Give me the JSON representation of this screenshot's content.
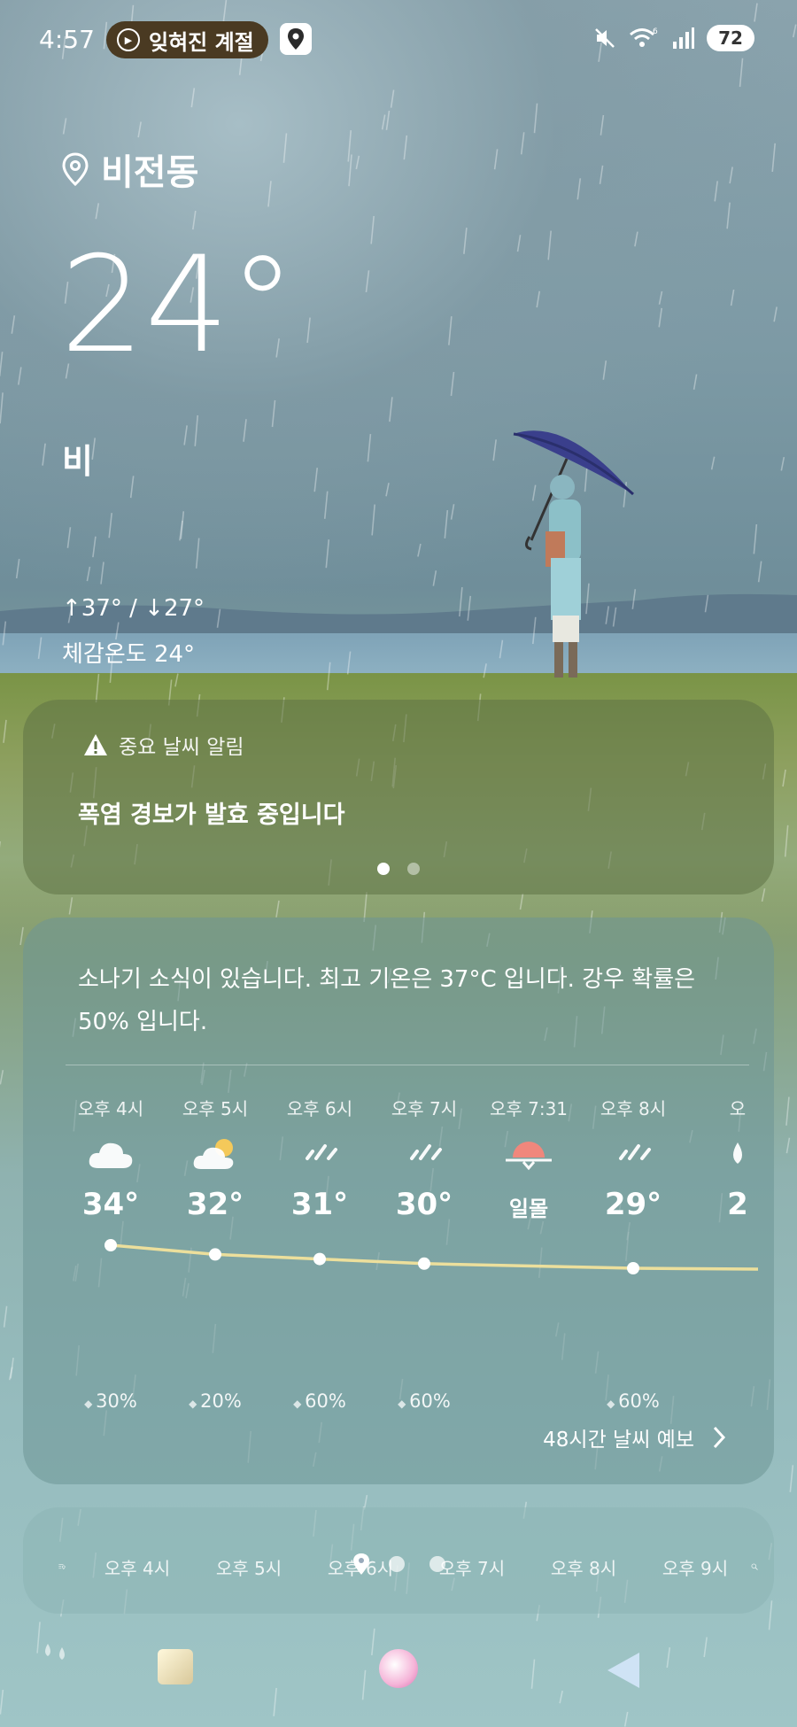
{
  "status_bar": {
    "time": "4:57",
    "notification_label": "잊혀진 계절",
    "battery": "72"
  },
  "location": "비전동",
  "temperature": "24°",
  "condition": "비",
  "hi_lo": "↑37° / ↓27°",
  "feels_like": "체감온도 24°",
  "alert": {
    "title": "중요 날씨 알림",
    "message": "폭염 경보가 발효 중입니다",
    "page": 1,
    "pages": 2
  },
  "forecast": {
    "summary": "소나기 소식이 있습니다. 최고 기온은 37°C 입니다. 강우 확률은 50% 입니다.",
    "hours": [
      {
        "label": "오후 4시",
        "icon": "cloud-icon",
        "temp": "34°",
        "temp_value": 34,
        "pop": "30%"
      },
      {
        "label": "오후 5시",
        "icon": "partly-sunny-icon",
        "temp": "32°",
        "temp_value": 32,
        "pop": "20%"
      },
      {
        "label": "오후 6시",
        "icon": "rain-icon",
        "temp": "31°",
        "temp_value": 31,
        "pop": "60%"
      },
      {
        "label": "오후 7시",
        "icon": "rain-icon",
        "temp": "30°",
        "temp_value": 30,
        "pop": "60%"
      },
      {
        "label": "오후 7:31",
        "icon": "sunset-icon",
        "temp": "일몰",
        "temp_value": null,
        "pop": ""
      },
      {
        "label": "오후 8시",
        "icon": "rain-icon",
        "temp": "29°",
        "temp_value": 29,
        "pop": "60%"
      },
      {
        "label": "오",
        "icon": "raindrop-icon",
        "temp": "2",
        "temp_value": null,
        "pop": ""
      }
    ],
    "more_label": "48시간 날씨 예보"
  },
  "bottom_strip": {
    "hours": [
      "오후 4시",
      "오후 5시",
      "오후 6시",
      "오후 7시",
      "오후 8시",
      "오후 9시"
    ]
  }
}
